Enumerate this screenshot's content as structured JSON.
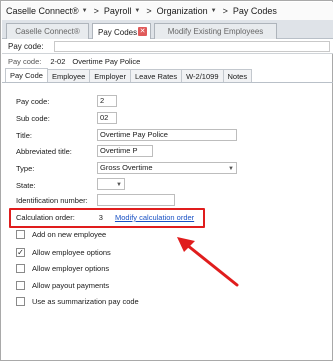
{
  "breadcrumb": {
    "items": [
      {
        "label": "Caselle Connect®"
      },
      {
        "label": "Payroll"
      },
      {
        "label": "Organization"
      }
    ],
    "last": "Pay Codes"
  },
  "tabs": [
    {
      "label": "Caselle Connect®"
    },
    {
      "label": "Pay Codes"
    },
    {
      "label": "Modify Existing Employees"
    }
  ],
  "header": {
    "pay_code_label": "Pay code:",
    "sub_label": "Pay code:",
    "sub_code": "2-02",
    "sub_name": "Overtime Pay Police"
  },
  "subtabs": [
    "Pay Code",
    "Employee",
    "Employer",
    "Leave Rates",
    "W-2/1099",
    "Notes"
  ],
  "form": {
    "pay_code_label": "Pay code:",
    "pay_code_value": "2",
    "sub_code_label": "Sub code:",
    "sub_code_value": "02",
    "title_label": "Title:",
    "title_value": "Overtime Pay Police",
    "abbrev_label": "Abbreviated title:",
    "abbrev_value": "Overtime P",
    "type_label": "Type:",
    "type_value": "Gross Overtime",
    "state_label": "State:",
    "state_value": "",
    "ident_label": "Identification number:",
    "ident_value": ""
  },
  "calc": {
    "label": "Calculation order:",
    "value": "3",
    "link": "Modify calculation order"
  },
  "checkboxes": [
    {
      "label": "Add on new employee",
      "checked": false
    },
    {
      "label": "Allow employee options",
      "checked": true
    },
    {
      "label": "Allow employer options",
      "checked": false
    },
    {
      "label": "Allow payout payments",
      "checked": false
    },
    {
      "label": "Use as summarization pay code",
      "checked": false
    }
  ],
  "colors": {
    "annotation": "#e01d1d",
    "link": "#1a52c4"
  }
}
